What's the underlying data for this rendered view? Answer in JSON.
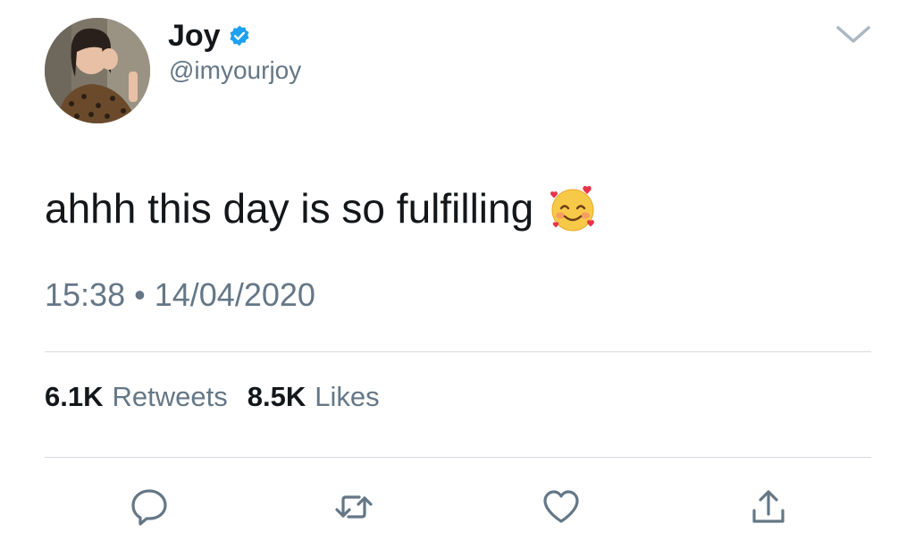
{
  "author": {
    "name": "Joy",
    "handle": "@imyourjoy",
    "verified": true,
    "verified_color": "#1da1f2"
  },
  "tweet": {
    "text": "ahhh this day is so fulfilling",
    "emoji_icon": "smiling-face-with-hearts-icon",
    "time": "15:38",
    "separator": "•",
    "date": "14/04/2020"
  },
  "stats": {
    "retweets_count": "6.1K",
    "retweets_label": "Retweets",
    "likes_count": "8.5K",
    "likes_label": "Likes"
  },
  "actions": [
    {
      "icon": "reply-icon"
    },
    {
      "icon": "retweet-icon"
    },
    {
      "icon": "like-icon"
    },
    {
      "icon": "share-icon"
    }
  ],
  "colors": {
    "text_primary": "#14171a",
    "text_secondary": "#657786",
    "divider": "#d6dbdf",
    "icon": "#657786"
  }
}
